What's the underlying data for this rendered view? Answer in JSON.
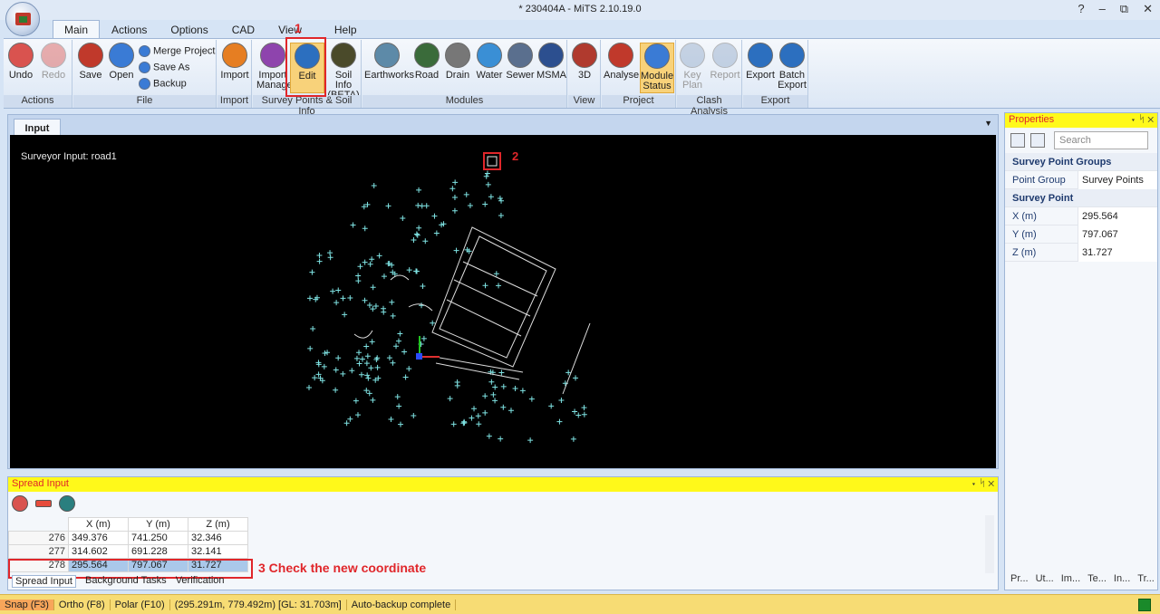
{
  "window": {
    "title": "* 230404A - MiTS 2.10.19.0",
    "controls": [
      "?",
      "–",
      "⧉",
      "✕"
    ]
  },
  "menu_tabs": [
    "Main",
    "Actions",
    "Options",
    "CAD",
    "View",
    "Help"
  ],
  "ribbon": {
    "groups": {
      "actions": "Actions",
      "file": "File",
      "import": "Import",
      "survey": "Survey Points & Soil Info",
      "modules": "Modules",
      "view": "View",
      "project": "Project",
      "clash": "Clash Analysis",
      "export": "Export"
    },
    "buttons": {
      "undo": "Undo",
      "redo": "Redo",
      "save": "Save",
      "open": "Open",
      "merge": "Merge Project",
      "save_as": "Save As",
      "backup": "Backup",
      "import": "Import",
      "import_manager": "Import Manager",
      "edit": "Edit",
      "soil_info": "Soil Info (BETA)",
      "earthworks": "Earthworks",
      "road": "Road",
      "drain": "Drain",
      "water": "Water",
      "sewer": "Sewer",
      "msma": "MSMA",
      "view3d": "3D",
      "analyse": "Analyse",
      "module_status": "Module Status",
      "key_plan": "Key Plan",
      "report": "Report",
      "export": "Export",
      "batch_export": "Batch Export"
    }
  },
  "annotations": {
    "step1": "1",
    "step2": "2",
    "step3": "3 Check the new coordinate"
  },
  "document": {
    "tab": "Input",
    "canvas_label": "Surveyor Input: road1"
  },
  "spread": {
    "title": "Spread Input",
    "columns": [
      "X (m)",
      "Y (m)",
      "Z (m)"
    ],
    "rows": [
      {
        "id": "276",
        "x": "349.376",
        "y": "741.250",
        "z": "32.346"
      },
      {
        "id": "277",
        "x": "314.602",
        "y": "691.228",
        "z": "32.141"
      },
      {
        "id": "278",
        "x": "295.564",
        "y": "797.067",
        "z": "31.727"
      }
    ],
    "bottom_tabs": [
      "Spread Input",
      "Background Tasks",
      "Verification"
    ]
  },
  "properties": {
    "title": "Properties",
    "search_placeholder": "Search",
    "cat1": "Survey Point Groups",
    "point_group_key": "Point Group",
    "point_group_val": "Survey Points",
    "cat2": "Survey Point",
    "x_key": "X (m)",
    "x_val": "295.564",
    "y_key": "Y (m)",
    "y_val": "797.067",
    "z_key": "Z (m)",
    "z_val": "31.727",
    "bottom_tabs": [
      "Pr...",
      "Ut...",
      "Im...",
      "Te...",
      "In...",
      "Tr..."
    ]
  },
  "statusbar": {
    "snap": "Snap (F3)",
    "ortho": "Ortho (F8)",
    "polar": "Polar (F10)",
    "coords": "(295.291m, 779.492m) [GL: 31.703m]",
    "message": "Auto-backup complete"
  },
  "colors": {
    "accent": "#e0262a",
    "points": "#7fe3e3",
    "highlight": "#f8d27a"
  }
}
